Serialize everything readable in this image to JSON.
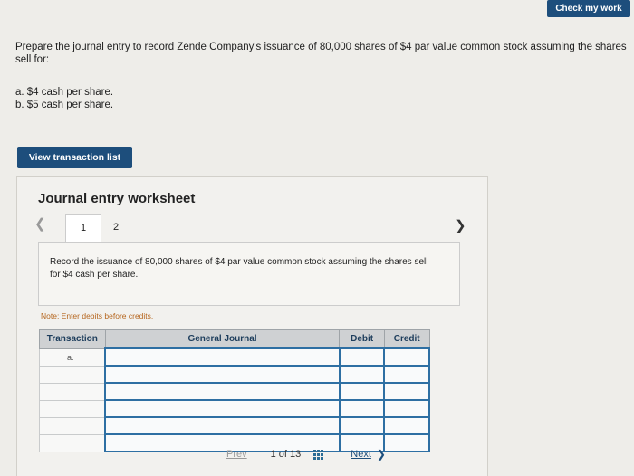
{
  "header": {
    "check_label": "Check my work"
  },
  "prompt": {
    "text": "Prepare the journal entry to record Zende Company's issuance of 80,000 shares of $4 par value common stock assuming the shares sell for:",
    "options": [
      "a. $4 cash per share.",
      "b. $5 cash per share."
    ]
  },
  "view_transactions_label": "View transaction list",
  "worksheet": {
    "title": "Journal entry worksheet",
    "tabs": [
      "1",
      "2"
    ],
    "instruction": "Record the issuance of 80,000 shares of $4 par value common stock assuming the shares sell for $4 cash per share.",
    "note": "Note: Enter debits before credits.",
    "columns": [
      "Transaction",
      "General Journal",
      "Debit",
      "Credit"
    ],
    "rows": [
      {
        "transaction": "a.",
        "account": "",
        "debit": "",
        "credit": ""
      },
      {
        "transaction": "",
        "account": "",
        "debit": "",
        "credit": ""
      },
      {
        "transaction": "",
        "account": "",
        "debit": "",
        "credit": ""
      },
      {
        "transaction": "",
        "account": "",
        "debit": "",
        "credit": ""
      },
      {
        "transaction": "",
        "account": "",
        "debit": "",
        "credit": ""
      },
      {
        "transaction": "",
        "account": "",
        "debit": "",
        "credit": ""
      }
    ]
  },
  "pager": {
    "prev_label": "Prev",
    "count_text": "1 of 13",
    "next_label": "Next"
  }
}
